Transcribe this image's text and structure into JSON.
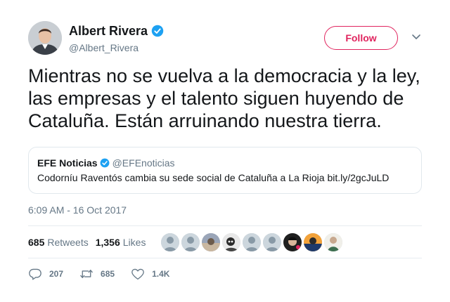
{
  "author": {
    "name": "Albert Rivera",
    "handle": "@Albert_Rivera",
    "verified_icon": "verified-badge-icon"
  },
  "header": {
    "follow_label": "Follow",
    "menu_icon": "chevron-down-icon"
  },
  "tweet": {
    "text": "Mientras no se vuelva a la democracia y la ley, las empresas y el talento siguen huyendo de Cataluña. Están arruinando nuestra tierra.",
    "timestamp": "6:09 AM - 16 Oct 2017"
  },
  "quote": {
    "name": "EFE Noticias",
    "handle": "@EFEnoticias",
    "text": "Codorníu Raventós cambia su sede social de Cataluña a La Rioja bit.ly/2gcJuLD"
  },
  "stats": {
    "retweets_count": "685",
    "retweets_label": "Retweets",
    "likes_count": "1,356",
    "likes_label": "Likes"
  },
  "actions": {
    "reply_count": "207",
    "retweet_count": "685",
    "like_count": "1.4K"
  },
  "colors": {
    "accent": "#e0245e",
    "verified": "#1da1f2",
    "secondary_text": "#657786",
    "border": "#e1e8ed"
  }
}
